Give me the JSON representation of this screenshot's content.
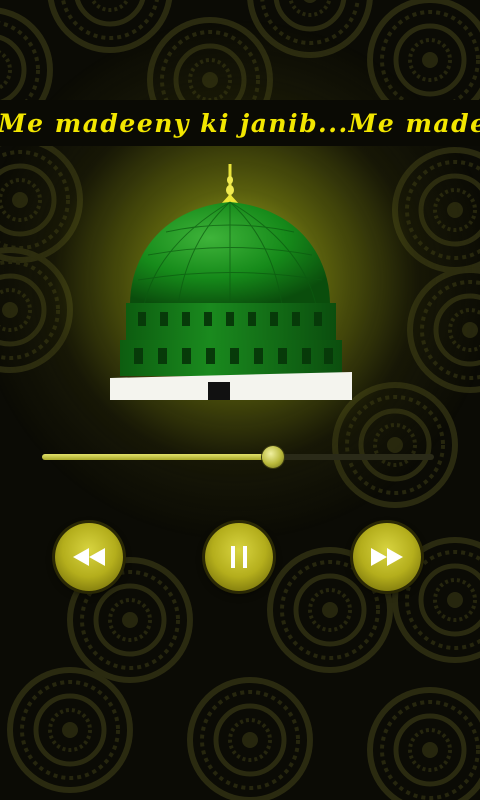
{
  "player": {
    "ticker_text": "Me madeeny ki janib...Me madeeny ki janib...Me madeeny ki janib...",
    "progress": 0.59
  },
  "controls": {
    "rewind_icon": "rewind-icon",
    "pause_icon": "pause-icon",
    "forward_icon": "fast-forward-icon"
  },
  "colors": {
    "accent": "#f2e600",
    "dome": "#1e8a1e",
    "background": "#0b0b05"
  }
}
